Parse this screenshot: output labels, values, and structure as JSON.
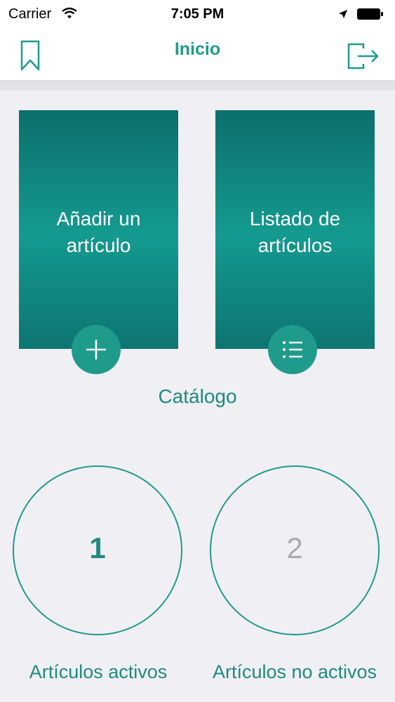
{
  "status_bar": {
    "carrier": "Carrier",
    "time": "7:05 PM"
  },
  "nav": {
    "title": "Inicio",
    "left_icon": "bookmark-icon",
    "right_icon": "logout-icon"
  },
  "catalog": {
    "section_label": "Catálogo",
    "tiles": [
      {
        "label": "Añadir un\nartículo",
        "icon": "plus-icon"
      },
      {
        "label": "Listado de\nartículos",
        "icon": "list-icon"
      }
    ]
  },
  "stats": [
    {
      "value": "1",
      "label": "Artículos activos"
    },
    {
      "value": "2",
      "label": "Artículos no activos"
    }
  ],
  "colors": {
    "accent": "#1f9b8c",
    "tile_dark": "#0c6f6b",
    "background": "#f0eff4",
    "inactive": "#a9a9ae"
  }
}
